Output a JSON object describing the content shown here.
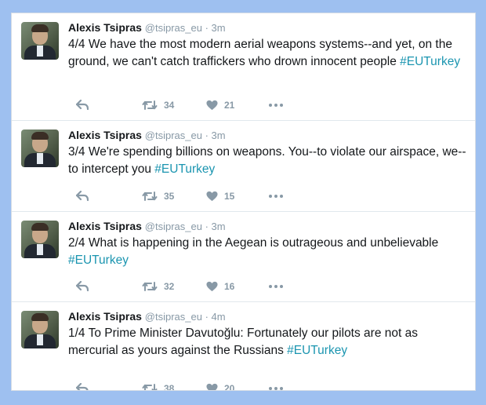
{
  "tweets": [
    {
      "name": "Alexis Tsipras",
      "meta": "@tsipras_eu · 3m",
      "text": "4/4 We have the most modern aerial weapons systems--and yet, on the ground, we can't catch traffickers who drown innocent people ",
      "hashtag": "#EUTurkey",
      "retweets": "34",
      "likes": "21"
    },
    {
      "name": "Alexis Tsipras",
      "meta": "@tsipras_eu · 3m",
      "text": "3/4 We're spending billions on weapons. You--to violate our airspace, we--to intercept you ",
      "hashtag": "#EUTurkey",
      "retweets": "35",
      "likes": "15"
    },
    {
      "name": "Alexis Tsipras",
      "meta": "@tsipras_eu · 3m",
      "text": "2/4 What is happening in the Aegean is outrageous and unbelievable ",
      "hashtag": "#EUTurkey",
      "retweets": "32",
      "likes": "16"
    },
    {
      "name": "Alexis Tsipras",
      "meta": "@tsipras_eu · 4m",
      "text": "1/4 To Prime Minister Davutoğlu: Fortunately our pilots are not as mercurial as yours against the Russians ",
      "hashtag": "#EUTurkey",
      "retweets": "38",
      "likes": "20"
    }
  ],
  "icons": {
    "reply": "reply-icon",
    "retweet": "retweet-icon",
    "like": "heart-icon",
    "more": "more-icon"
  },
  "colors": {
    "page_background": "#9ec0f0",
    "hashtag": "#1b95b0",
    "icon_gray": "#8899a6"
  }
}
